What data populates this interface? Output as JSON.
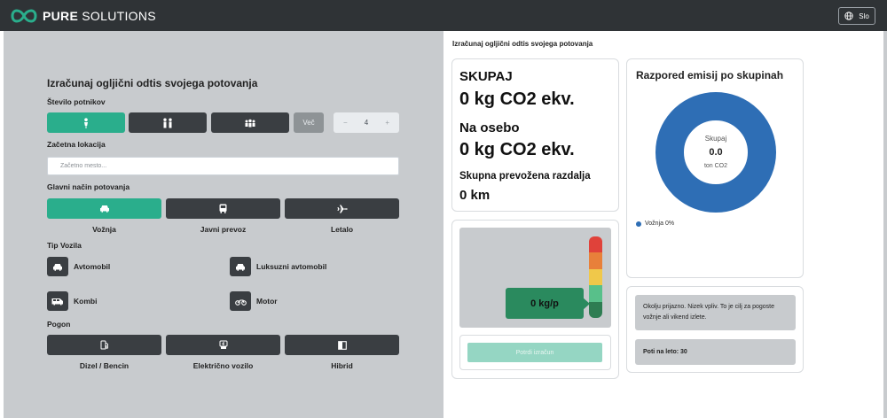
{
  "header": {
    "brand_bold": "PURE",
    "brand_rest": " SOLUTIONS",
    "lang_label": "Slo",
    "lang_icon": "globe-icon"
  },
  "form": {
    "title": "Izračunaj ogljični odtis svojega potovanja",
    "passengers_label": "Število potnikov",
    "passenger_buttons": [
      {
        "icon": "person-icon"
      },
      {
        "icon": "two-people-icon"
      },
      {
        "icon": "group-icon"
      }
    ],
    "more_label": "Več",
    "stepper": {
      "minus": "−",
      "value": "4",
      "plus": "+"
    },
    "start_label": "Začetna lokacija",
    "start_placeholder": "Začetno mesto...",
    "mode_label": "Glavni način potovanja",
    "modes": [
      {
        "label": "Vožnja",
        "icon": "car-icon"
      },
      {
        "label": "Javni prevoz",
        "icon": "bus-icon"
      },
      {
        "label": "Letalo",
        "icon": "plane-icon"
      }
    ],
    "vehicle_label": "Tip Vozila",
    "vehicles": [
      {
        "label": "Avtomobil",
        "icon": "car-icon"
      },
      {
        "label": "Luksuzni avtomobil",
        "icon": "car-icon"
      },
      {
        "label": "Kombi",
        "icon": "van-icon"
      },
      {
        "label": "Motor",
        "icon": "motorcycle-icon"
      }
    ],
    "drive_label": "Pogon",
    "drives": [
      {
        "label": "Dizel / Bencin",
        "icon": "fuel-icon"
      },
      {
        "label": "Električno vozilo",
        "icon": "charging-station-icon"
      },
      {
        "label": "Hibrid",
        "icon": "half-square-icon"
      }
    ]
  },
  "results": {
    "heading": "Izračunaj ogljični odtis svojega potovanja",
    "total_label": "SKUPAJ",
    "total_value": "0 kg CO2 ekv.",
    "per_person_label": "Na osebo",
    "per_person_value": "0 kg CO2 ekv.",
    "distance_label": "Skupna prevožena razdalja",
    "distance_value": "0 km",
    "meter_value": "0 kg/p",
    "meter_colors": [
      "#e0423a",
      "#e8803a",
      "#f0c84a",
      "#58c08a",
      "#2e7d52"
    ],
    "confirm_label": "Potrdi izračun"
  },
  "donut": {
    "title": "Razpored emisij po skupinah",
    "center_label": "Skupaj",
    "center_value": "0.0",
    "center_unit": "ton CO2",
    "color": "#2e6eb5",
    "legend": "Vožnja 0%"
  },
  "info": {
    "message": "Okolju prijazno. Nizek vpliv. To je cilj za pogoste vožnje ali vikend izlete.",
    "trips_label": "Poti na leto: 30"
  }
}
